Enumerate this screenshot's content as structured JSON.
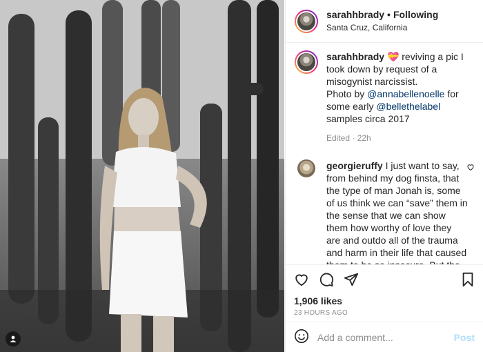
{
  "post": {
    "username": "sarahhbrady",
    "dot": "•",
    "follow_label": "Following",
    "location": "Santa Cruz, California"
  },
  "caption": {
    "username": "sarahhbrady",
    "emoji": "💝",
    "text_1": " reviving a pic I took down by request of a misogynist narcissist.",
    "text_2": "Photo by ",
    "mention_1": "@annabellenoelle",
    "text_3": " for some early ",
    "mention_2": "@bellethelabel",
    "text_4": " samples circa 2017",
    "meta": "Edited · 22h"
  },
  "comment": {
    "username": "georgieruffy",
    "text": " I just want to say, from behind my dog finsta, that the type of man Jonah is, some of us think we can “save” them in the sense that we can show them how worthy of love they are and outdo all of the trauma and harm in their life that caused them to be so insecure. But the reality is, men like Jonah, they will resent you for the rest of their lives for being the type of woman / person who they"
  },
  "engagement": {
    "likes": "1,906 likes",
    "time": "23 HOURS AGO"
  },
  "compose": {
    "placeholder": "Add a comment...",
    "post_label": "Post"
  },
  "icons": [
    "heart-icon",
    "comment-icon",
    "share-icon",
    "bookmark-icon",
    "emoji-icon",
    "tag-user-icon",
    "heart-small-icon"
  ]
}
